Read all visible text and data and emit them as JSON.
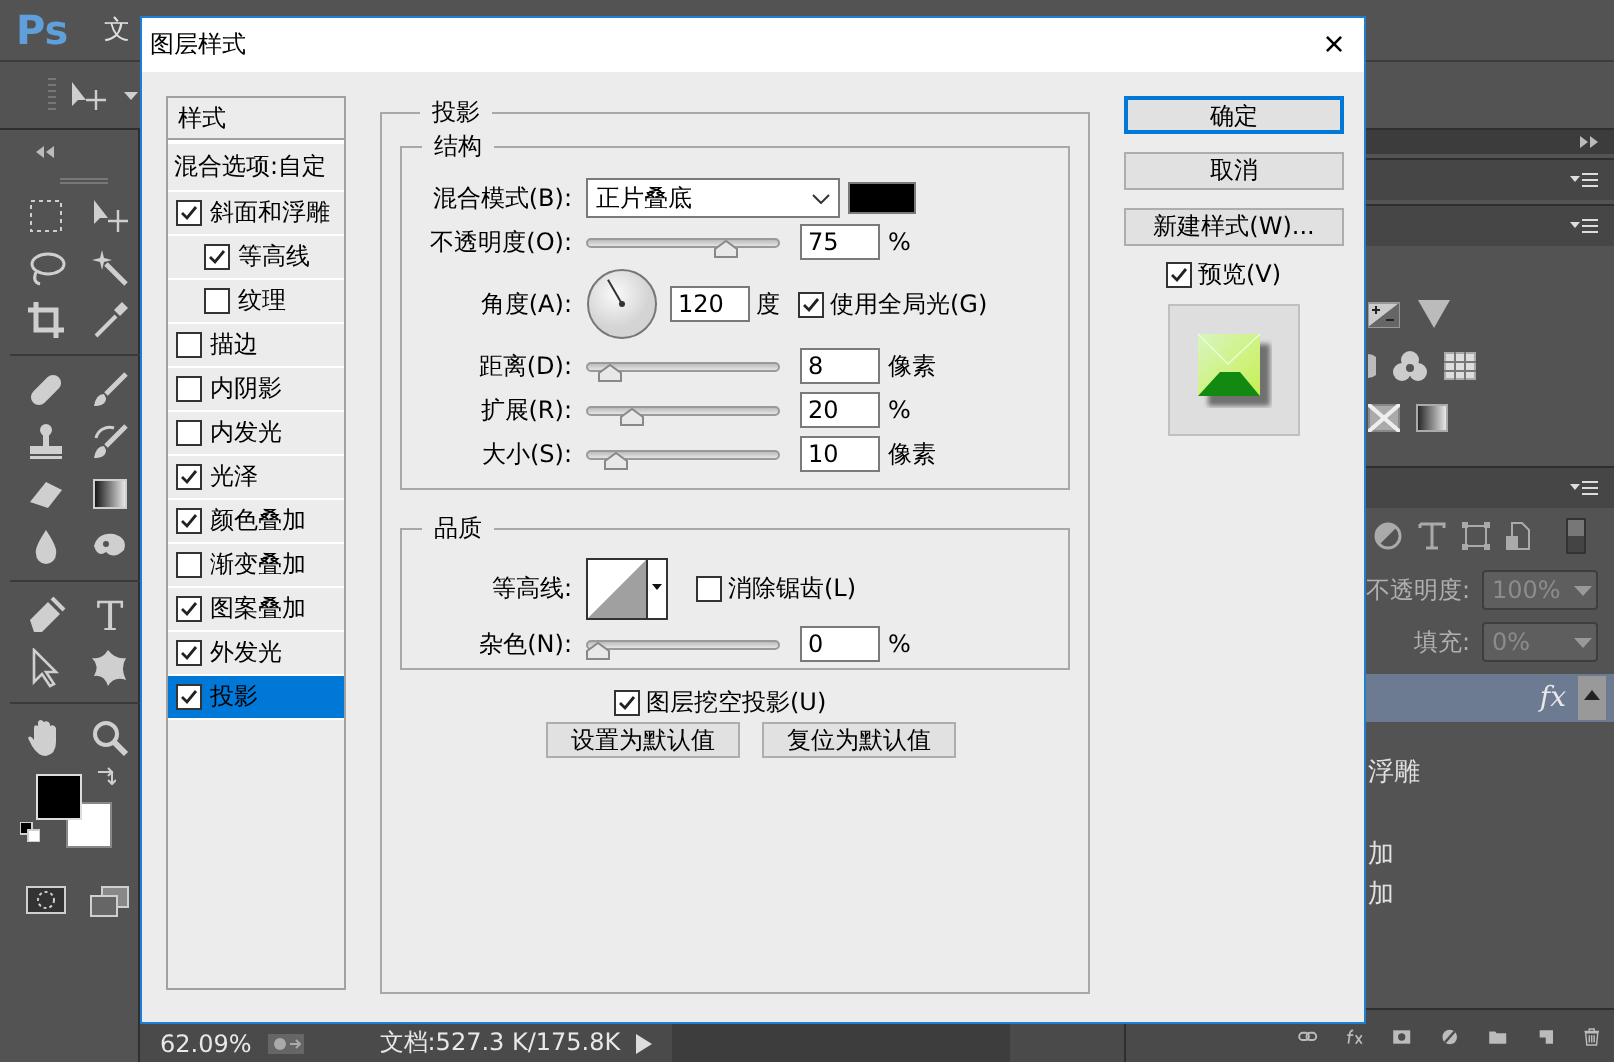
{
  "app": {
    "logo": "Ps",
    "menu": [
      "文"
    ],
    "type_tool": "T"
  },
  "layers_panel": {
    "opacity_label": "不透明度:",
    "opacity": "100%",
    "fill_label": "填充:",
    "fill": "0%",
    "disabled": true,
    "layers": [
      {
        "fx": "fx",
        "selected": true,
        "effects": [
          "浮雕",
          "加",
          "加"
        ]
      }
    ]
  },
  "status_bar": {
    "zoom": "62.09%",
    "document": "文档:527.3 K/175.8K"
  },
  "dialog": {
    "title": "图层样式",
    "close": "×",
    "styles_header": "样式",
    "blend_options": "混合选项:自定",
    "styles": [
      {
        "label": "斜面和浮雕",
        "checked": true,
        "selected": false,
        "children": [
          {
            "label": "等高线",
            "checked": true,
            "selected": false
          },
          {
            "label": "纹理",
            "checked": false,
            "selected": false
          }
        ]
      },
      {
        "label": "描边",
        "checked": false,
        "selected": false
      },
      {
        "label": "内阴影",
        "checked": false,
        "selected": false
      },
      {
        "label": "内发光",
        "checked": false,
        "selected": false
      },
      {
        "label": "光泽",
        "checked": true,
        "selected": false
      },
      {
        "label": "颜色叠加",
        "checked": true,
        "selected": false
      },
      {
        "label": "渐变叠加",
        "checked": false,
        "selected": false
      },
      {
        "label": "图案叠加",
        "checked": true,
        "selected": false
      },
      {
        "label": "外发光",
        "checked": true,
        "selected": false
      },
      {
        "label": "投影",
        "checked": true,
        "selected": true
      }
    ],
    "section": "投影",
    "structure": {
      "title": "结构",
      "blend_label": "混合模式(B):",
      "blend_mode": "正片叠底",
      "color": "#000000",
      "rows": [
        {
          "kind": "slider",
          "label": "不透明度(O):",
          "value": "75",
          "unit": "%",
          "level": 0.75
        },
        {
          "kind": "angle",
          "label": "角度(A):",
          "value": "120",
          "unit": "度",
          "option": {
            "label": "使用全局光(G)",
            "checked": true
          }
        },
        {
          "kind": "slider",
          "label": "距离(D):",
          "value": "8",
          "unit": "像素",
          "level": 0.07
        },
        {
          "kind": "slider",
          "label": "扩展(R):",
          "value": "20",
          "unit": "%",
          "level": 0.2
        },
        {
          "kind": "slider",
          "label": "大小(S):",
          "value": "10",
          "unit": "像素",
          "level": 0.1
        }
      ]
    },
    "quality": {
      "title": "品质",
      "contour_label": "等高线:",
      "anti_alias": {
        "label": "消除锯齿(L)",
        "checked": false
      },
      "noise": {
        "label": "杂色(N):",
        "value": "0",
        "unit": "%",
        "level": 0
      }
    },
    "knockout": {
      "label": "图层挖空投影(U)",
      "checked": true
    },
    "default_buttons": [
      "设置为默认值",
      "复位为默认值"
    ],
    "actions": [
      {
        "label": "确定",
        "default": true
      },
      {
        "label": "取消",
        "default": false
      },
      {
        "label": "新建样式(W)...",
        "default": false
      }
    ],
    "preview": {
      "label": "预览(V)",
      "checked": true
    }
  }
}
